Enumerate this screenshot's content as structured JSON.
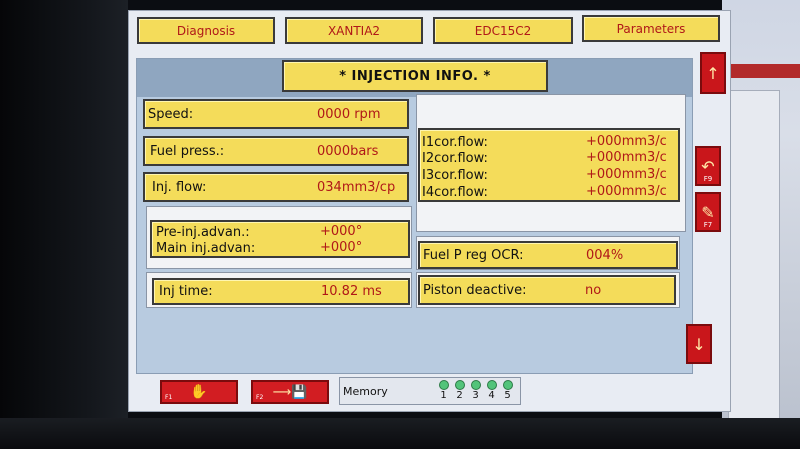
{
  "tabs": [
    "Diagnosis",
    "XANTIA2",
    "EDC15C2",
    "Parameters"
  ],
  "title": "* INJECTION INFO. *",
  "left_fields": {
    "speed": {
      "label": "Speed:",
      "value": "0000 rpm"
    },
    "fuel_press": {
      "label": "Fuel press.:",
      "value": "0000bars"
    },
    "inj_flow": {
      "label": "Inj. flow:",
      "value": "034mm3/cp"
    },
    "pre_inj": {
      "label": "Pre-inj.advan.:",
      "value": "+000°"
    },
    "main_inj": {
      "label": "Main inj.advan:",
      "value": "+000°"
    },
    "inj_time": {
      "label": "Inj time:",
      "value": "10.82 ms"
    }
  },
  "cor_flows": [
    {
      "label": "I1cor.flow:",
      "value": "+000mm3/c"
    },
    {
      "label": "I2cor.flow:",
      "value": "+000mm3/c"
    },
    {
      "label": "I3cor.flow:",
      "value": "+000mm3/c"
    },
    {
      "label": "I4cor.flow:",
      "value": "+000mm3/c"
    }
  ],
  "right_fields": {
    "fuel_p_reg": {
      "label": "Fuel P reg OCR:",
      "value": "004%"
    },
    "piston": {
      "label": "Piston deactive:",
      "value": "no"
    }
  },
  "side_buttons": {
    "scroll_up_icon": "arrow-up-icon",
    "f9_label": "F9",
    "f7_label": "F7",
    "scroll_down_icon": "arrow-down-icon"
  },
  "bottom": {
    "f1_label": "F1",
    "f2_label": "F2",
    "memory_label": "Memory",
    "memory_slots": [
      "1",
      "2",
      "3",
      "4",
      "5"
    ]
  },
  "colors": {
    "field_bg": "#f4dc5a",
    "value_text": "#b01818",
    "button_red": "#d21d22",
    "led_green": "#52c47a"
  }
}
